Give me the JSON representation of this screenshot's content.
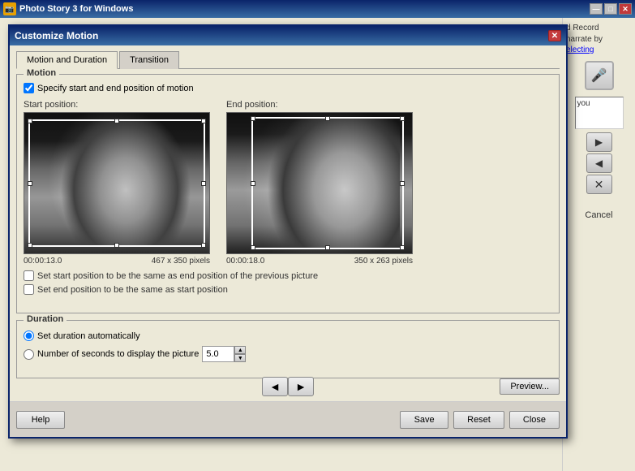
{
  "window": {
    "title": "Photo Story 3 for Windows",
    "icon": "📷"
  },
  "dialog": {
    "title": "Customize Motion",
    "close_btn": "✕"
  },
  "tabs": [
    {
      "id": "motion",
      "label": "Motion and Duration",
      "active": true
    },
    {
      "id": "transition",
      "label": "Transition",
      "active": false
    }
  ],
  "motion_group": {
    "label": "Motion",
    "specify_checkbox_label": "Specify start and end position of motion",
    "specify_checked": true
  },
  "start_position": {
    "label": "Start position:",
    "timestamp": "00:00:13.0",
    "dimensions": "467 x 350 pixels"
  },
  "end_position": {
    "label": "End position:",
    "timestamp": "00:00:18.0",
    "dimensions": "350 x 263 pixels"
  },
  "options": {
    "same_as_prev_label": "Set start position to be the same as end position of the previous picture",
    "same_as_start_label": "Set end position to be the same as start position",
    "same_as_prev_checked": false,
    "same_as_start_checked": false
  },
  "duration_group": {
    "label": "Duration",
    "auto_radio_label": "Set duration automatically",
    "auto_checked": true,
    "seconds_radio_label": "Number of seconds to display the picture",
    "seconds_checked": false,
    "seconds_value": "5.0"
  },
  "nav": {
    "prev_label": "◄",
    "next_label": "►",
    "preview_label": "Preview..."
  },
  "actions": {
    "help_label": "Help",
    "save_label": "Save",
    "reset_label": "Reset",
    "close_label": "Close"
  },
  "right_panel": {
    "text1": "d Record",
    "text2": "narrate by",
    "link": "electing",
    "you_text": "you",
    "cancel_label": "Cancel"
  },
  "titlebar_btns": {
    "minimize": "—",
    "maximize": "□",
    "close": "✕"
  }
}
